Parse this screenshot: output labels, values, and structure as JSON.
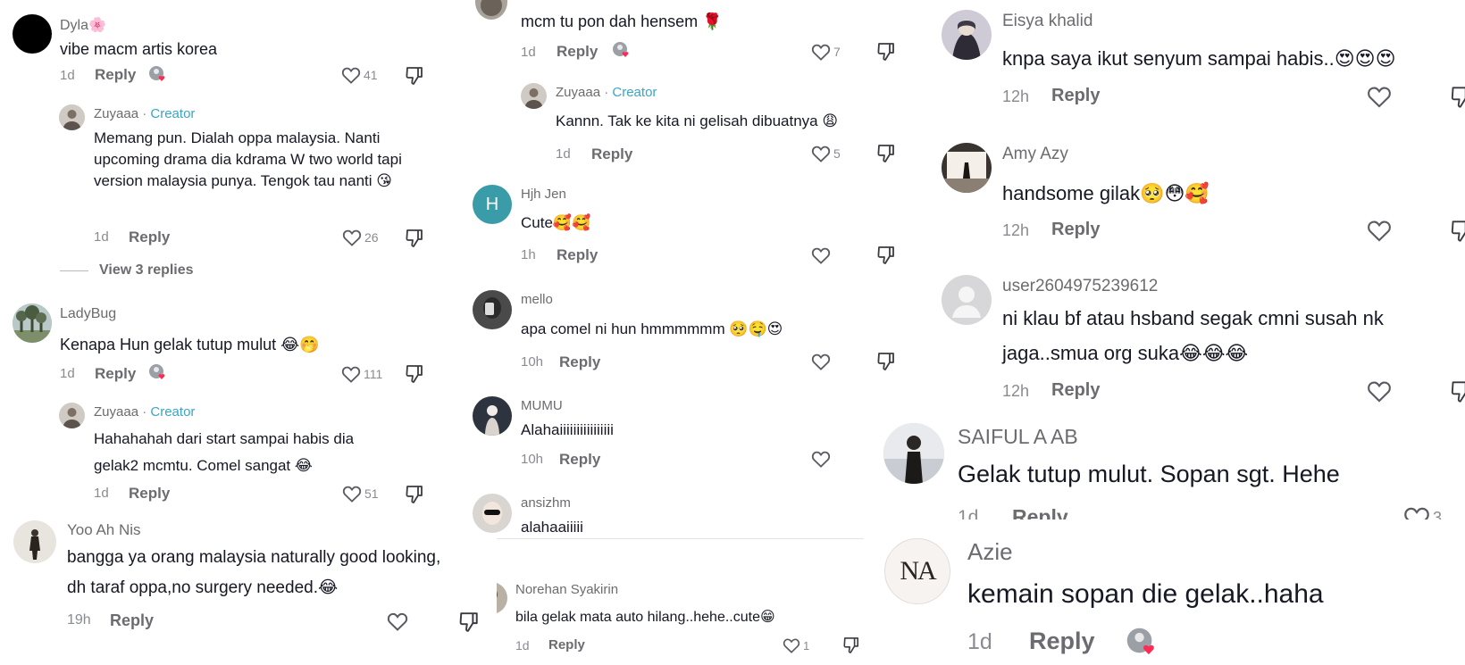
{
  "col1": {
    "c1": {
      "user": "Dyla",
      "user_emoji": "🌸",
      "text": "vibe macm artis korea",
      "time": "1d",
      "reply": "Reply",
      "likes": "41"
    },
    "c1r": {
      "user": "Zuyaaa",
      "sep": "·",
      "badge": "Creator",
      "text": "Memang pun. Dialah oppa malaysia. Nanti upcoming drama dia kdrama W two world tapi version malaysia punya. Tengok tau nanti 😘",
      "time": "1d",
      "reply": "Reply",
      "likes": "26"
    },
    "view_replies": "View 3 replies",
    "c2": {
      "user": "LadyBug",
      "text": "Kenapa Hun gelak tutup mulut 😂🤭",
      "time": "1d",
      "reply": "Reply",
      "likes": "111"
    },
    "c2r": {
      "user": "Zuyaaa",
      "sep": "·",
      "badge": "Creator",
      "text": "Hahahahah dari start sampai habis dia gelak2 mcmtu. Comel sangat 😂",
      "time": "1d",
      "reply": "Reply",
      "likes": "51"
    },
    "c3": {
      "user": "Yoo Ah Nis",
      "text": "bangga ya orang malaysia naturally good looking, dh taraf oppa,no surgery needed.😂",
      "time": "19h",
      "reply": "Reply"
    }
  },
  "col2": {
    "c0": {
      "text": "mcm tu pon dah hensem 🌹",
      "time": "1d",
      "reply": "Reply",
      "likes": "7"
    },
    "c0r": {
      "user": "Zuyaaa",
      "sep": "·",
      "badge": "Creator",
      "text": "Kannn. Tak ke kita ni gelisah dibuatnya 😩",
      "time": "1d",
      "reply": "Reply",
      "likes": "5"
    },
    "c1": {
      "user": "Hjh Jen",
      "initial": "H",
      "text": "Cute🥰🥰",
      "time": "1h",
      "reply": "Reply"
    },
    "c2": {
      "user": "mello",
      "text": "apa comel ni hun hmmmmmm 🥺🤤😍",
      "time": "10h",
      "reply": "Reply"
    },
    "c3": {
      "user": "MUMU",
      "text": "Alahaiiiiiiiiiiiiiiii",
      "time": "10h",
      "reply": "Reply"
    },
    "c4": {
      "user": "ansizhm",
      "text": "alahaaiiiii"
    },
    "c5": {
      "user": "Norehan Syakirin",
      "text": "bila gelak mata auto hilang..hehe..cute😁",
      "time": "1d",
      "reply": "Reply",
      "likes": "1"
    }
  },
  "col3": {
    "c1": {
      "user": "Eisya khalid",
      "text": "knpa saya ikut senyum sampai habis..😍😍😍",
      "time": "12h",
      "reply": "Reply"
    },
    "c2": {
      "user": "Amy Azy",
      "text": "handsome gilak🥺😳🥰",
      "time": "12h",
      "reply": "Reply"
    },
    "c3": {
      "user": "user2604975239612",
      "text": "ni klau bf atau hsband segak cmni susah nk jaga..smua org suka😂😂😂",
      "time": "12h",
      "reply": "Reply"
    },
    "c4": {
      "user": "SAIFUL A AB",
      "text": "Gelak tutup mulut. Sopan sgt. Hehe",
      "time": "1d",
      "reply": "Reply",
      "likes": "3"
    },
    "c5": {
      "user": "Azie",
      "avatar_logo": "NA",
      "text": "kemain sopan die gelak..haha",
      "time": "1d",
      "reply": "Reply"
    }
  },
  "colors": {
    "creator": "#3aa6c2",
    "muted": "#8a8b91",
    "text": "#161823",
    "liked_heart": "#fe2c55"
  }
}
